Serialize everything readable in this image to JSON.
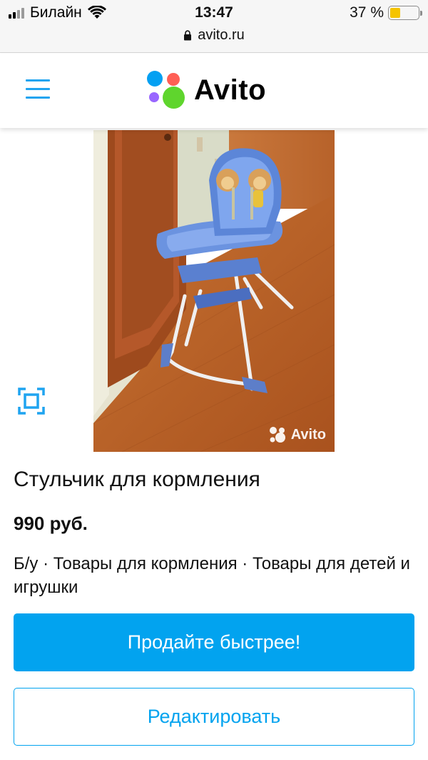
{
  "status_bar": {
    "carrier": "Билайн",
    "time": "13:47",
    "battery": "37 %",
    "battery_level": 0.37,
    "url": "avito.ru"
  },
  "header": {
    "logo_text": "Avito",
    "logo_dot_colors": [
      "#04a0f2",
      "#ff5f55",
      "#9966ff",
      "#5fd52d"
    ]
  },
  "listing": {
    "photo_watermark": "Avito",
    "title": "Стульчик для кормления",
    "price": "990 руб.",
    "category": "Б/у · Товары для кормления · Товары для детей и игрушки"
  },
  "actions": {
    "promote_label": "Продайте быстрее!",
    "edit_label": "Редактировать"
  },
  "colors": {
    "accent": "#02a3ef",
    "battery": "#f5c400"
  }
}
